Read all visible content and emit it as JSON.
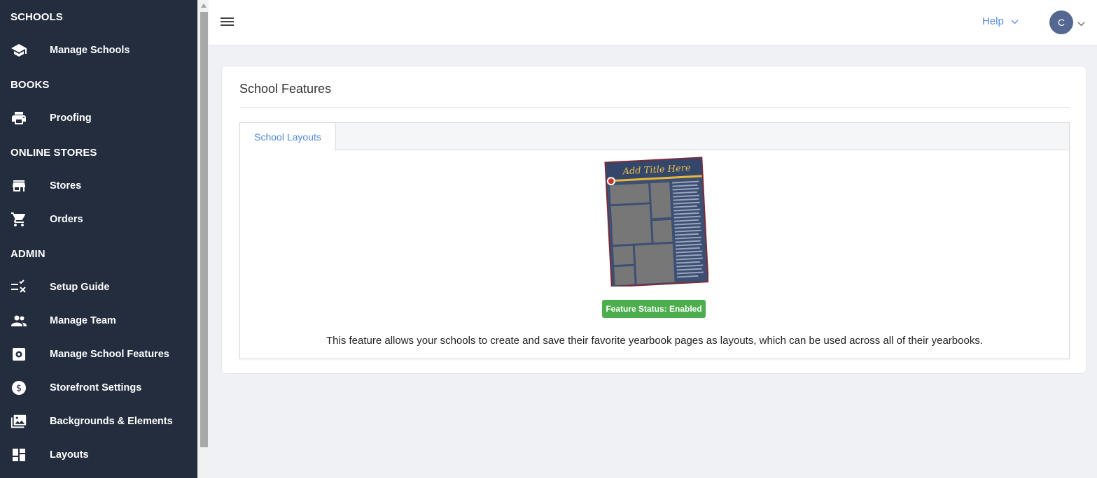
{
  "sidebar": {
    "sections": [
      {
        "title": "SCHOOLS"
      },
      {
        "title": "BOOKS"
      },
      {
        "title": "ONLINE STORES"
      },
      {
        "title": "ADMIN"
      }
    ],
    "items": [
      {
        "label": "Manage Schools",
        "icon": "graduation-cap-icon"
      },
      {
        "label": "Proofing",
        "icon": "printer-icon"
      },
      {
        "label": "Stores",
        "icon": "storefront-icon"
      },
      {
        "label": "Orders",
        "icon": "cart-icon"
      },
      {
        "label": "Setup Guide",
        "icon": "checklist-icon"
      },
      {
        "label": "Manage Team",
        "icon": "people-icon"
      },
      {
        "label": "Manage School Features",
        "icon": "gear-icon"
      },
      {
        "label": "Storefront Settings",
        "icon": "dollar-icon"
      },
      {
        "label": "Backgrounds & Elements",
        "icon": "photos-icon"
      },
      {
        "label": "Layouts",
        "icon": "dashboard-icon"
      }
    ]
  },
  "topbar": {
    "help_label": "Help",
    "avatar_initial": "C"
  },
  "main": {
    "title": "School Features",
    "tabs": [
      {
        "label": "School Layouts",
        "active": true
      }
    ],
    "layout_preview": {
      "title_text": "Add Title Here"
    },
    "feature_status": "Feature Status: Enabled",
    "description": "This feature allows your schools to create and save their favorite yearbook pages as layouts, which can be used across all of their yearbooks."
  },
  "colors": {
    "sidebar_bg": "#232d3e",
    "accent": "#5b8dd6",
    "status_enabled": "#4cae4c",
    "avatar_bg": "#546791"
  }
}
